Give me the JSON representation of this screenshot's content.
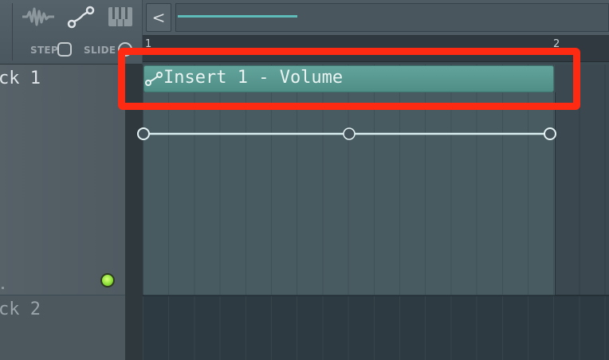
{
  "toolbar": {
    "tool_icons": [
      "audio-wave-icon",
      "automation-curve-icon",
      "piano-keys-icon"
    ],
    "step_label": "STEP",
    "slide_label": "SLIDE"
  },
  "navigation": {
    "back_icon": "chevron-left-icon",
    "back_glyph": "<"
  },
  "ruler": {
    "bar_start": "1",
    "bar_next": "2"
  },
  "tracks": [
    {
      "label": "ck 1"
    },
    {
      "label": "ck 2"
    }
  ],
  "automation_clip": {
    "title": "Insert 1 - Volume",
    "icon": "automation-curve-icon",
    "level": 0.5,
    "points": 3
  },
  "colors": {
    "accent": "#5fbdb9",
    "clip_header": "#5a9c94",
    "highlight": "#ff2a12",
    "mute_led": "#8de03a"
  }
}
